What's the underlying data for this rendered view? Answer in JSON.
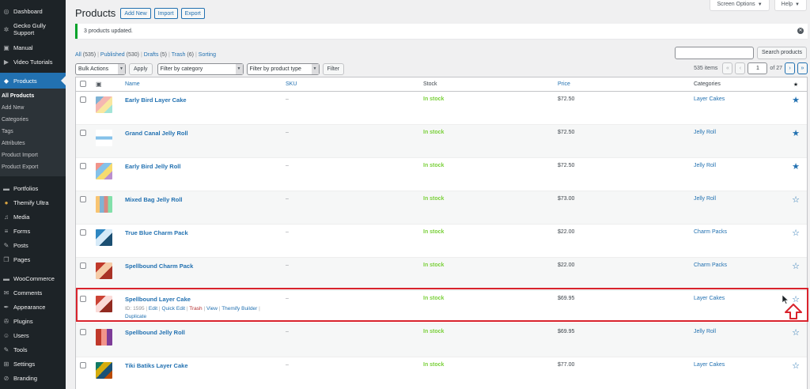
{
  "sidebar": {
    "items": [
      {
        "label": "Dashboard",
        "icon": "◎"
      },
      {
        "label": "Gecko Gully Support",
        "icon": "✲"
      },
      {
        "label": "Manual",
        "icon": "▣"
      },
      {
        "label": "Video Tutorials",
        "icon": "▶"
      },
      {
        "label": "Products",
        "icon": "◆"
      },
      {
        "label": "Portfolios",
        "icon": "▬"
      },
      {
        "label": "Themify Ultra",
        "icon": "●"
      },
      {
        "label": "Media",
        "icon": "♫"
      },
      {
        "label": "Forms",
        "icon": "≡"
      },
      {
        "label": "Posts",
        "icon": "✎"
      },
      {
        "label": "Pages",
        "icon": "❐"
      },
      {
        "label": "WooCommerce",
        "icon": "▬"
      },
      {
        "label": "Comments",
        "icon": "✉"
      },
      {
        "label": "Appearance",
        "icon": "✒"
      },
      {
        "label": "Plugins",
        "icon": "✇"
      },
      {
        "label": "Users",
        "icon": "☺"
      },
      {
        "label": "Tools",
        "icon": "✎"
      },
      {
        "label": "Settings",
        "icon": "⊞"
      },
      {
        "label": "Branding",
        "icon": "⊘"
      }
    ],
    "submenu": [
      "All Products",
      "Add New",
      "Categories",
      "Tags",
      "Attributes",
      "Product Import",
      "Product Export"
    ]
  },
  "screen_meta": {
    "screen_options": "Screen Options",
    "help": "Help"
  },
  "header": {
    "title": "Products",
    "add_new": "Add New",
    "import": "Import",
    "export": "Export"
  },
  "notice": {
    "text": "3 products updated."
  },
  "views": {
    "all": "All",
    "all_count": "(535)",
    "published": "Published",
    "published_count": "(530)",
    "drafts": "Drafts",
    "drafts_count": "(5)",
    "trash": "Trash",
    "trash_count": "(6)",
    "sorting": "Sorting"
  },
  "search": {
    "button": "Search products"
  },
  "tablenav": {
    "bulk_actions": "Bulk Actions",
    "apply": "Apply",
    "filter_category": "Filter by category",
    "filter_type": "Filter by product type",
    "filter_button": "Filter",
    "items_count": "535 items",
    "first": "«",
    "prev": "‹",
    "current_page": "1",
    "of_pages": "of 27",
    "next": "›",
    "last": "»"
  },
  "columns": {
    "name": "Name",
    "sku": "SKU",
    "stock": "Stock",
    "price": "Price",
    "categories": "Categories",
    "featured": "★"
  },
  "rows": [
    {
      "name": "Early Bird Layer Cake",
      "sku": "–",
      "stock": "In stock",
      "price": "$72.50",
      "category": "Layer Cakes",
      "featured": "★"
    },
    {
      "name": "Grand Canal Jelly Roll",
      "sku": "–",
      "stock": "In stock",
      "price": "$72.50",
      "category": "Jelly Roll",
      "featured": "★"
    },
    {
      "name": "Early Bird Jelly Roll",
      "sku": "–",
      "stock": "In stock",
      "price": "$72.50",
      "category": "Jelly Roll",
      "featured": "★"
    },
    {
      "name": "Mixed Bag Jelly Roll",
      "sku": "–",
      "stock": "In stock",
      "price": "$73.00",
      "category": "Jelly Roll",
      "featured": "☆"
    },
    {
      "name": "True Blue Charm Pack",
      "sku": "–",
      "stock": "In stock",
      "price": "$22.00",
      "category": "Charm Packs",
      "featured": "☆"
    },
    {
      "name": "Spellbound Charm Pack",
      "sku": "–",
      "stock": "In stock",
      "price": "$22.00",
      "category": "Charm Packs",
      "featured": "☆"
    },
    {
      "name": "Spellbound Layer Cake",
      "sku": "–",
      "stock": "In stock",
      "price": "$69.95",
      "category": "Layer Cakes",
      "featured": "☆",
      "id": "ID: 1595",
      "edit": "Edit",
      "quick_edit": "Quick Edit",
      "trash": "Trash",
      "view": "View",
      "builder": "Themify Builder",
      "duplicate": "Duplicate"
    },
    {
      "name": "Spellbound Jelly Roll",
      "sku": "–",
      "stock": "In stock",
      "price": "$69.95",
      "category": "Jelly Roll",
      "featured": "☆"
    },
    {
      "name": "Tiki Batiks Layer Cake",
      "sku": "–",
      "stock": "In stock",
      "price": "$77.00",
      "category": "Layer Cakes",
      "featured": "☆"
    }
  ],
  "colors": {
    "accent": "#2271b1",
    "sidebar": "#1d2327",
    "highlight": "#d9232d",
    "in_stock": "#7ad03a"
  }
}
